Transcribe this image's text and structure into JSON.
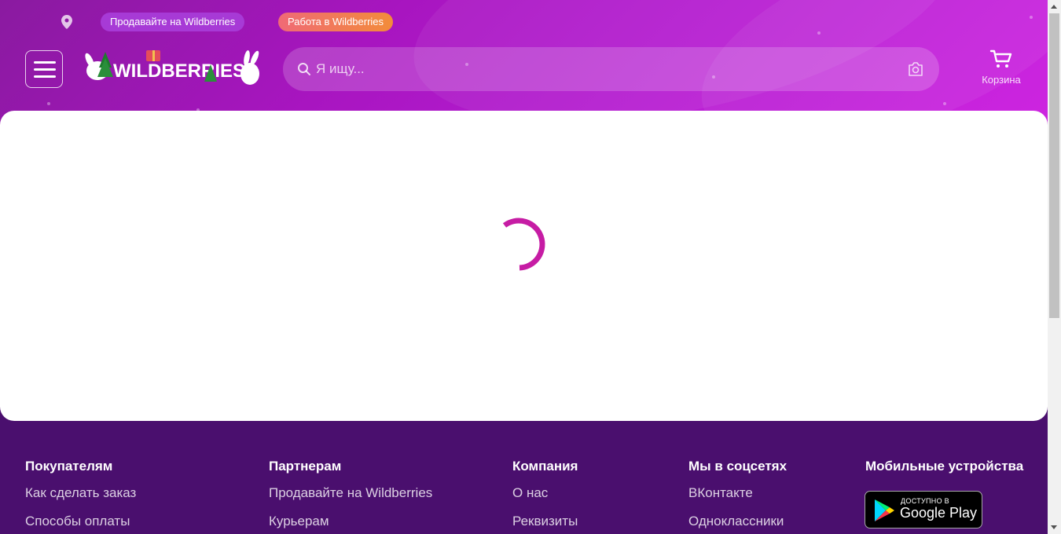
{
  "header": {
    "sell_pill": "Продавайте на Wildberries",
    "work_pill": "Работа в Wildberries",
    "logo_text": "WILDBERRIES",
    "search_placeholder": "Я ищу...",
    "cart_label": "Корзина"
  },
  "footer": {
    "columns": [
      {
        "title": "Покупателям",
        "links": [
          "Как сделать заказ",
          "Способы оплаты"
        ]
      },
      {
        "title": "Партнерам",
        "links": [
          "Продавайте на Wildberries",
          "Курьерам"
        ]
      },
      {
        "title": "Компания",
        "links": [
          "О нас",
          "Реквизиты"
        ]
      },
      {
        "title": "Мы в соцсетях",
        "links": [
          "ВКонтакте",
          "Одноклассники"
        ]
      },
      {
        "title": "Мобильные устройства",
        "links": []
      }
    ],
    "google_play": {
      "small": "ДОСТУПНО В",
      "big": "Google Play"
    }
  },
  "colors": {
    "accent": "#cb11ab",
    "header_start": "#8a1aa0",
    "header_end": "#cd25e0",
    "footer_bg": "#4a0f6e"
  }
}
